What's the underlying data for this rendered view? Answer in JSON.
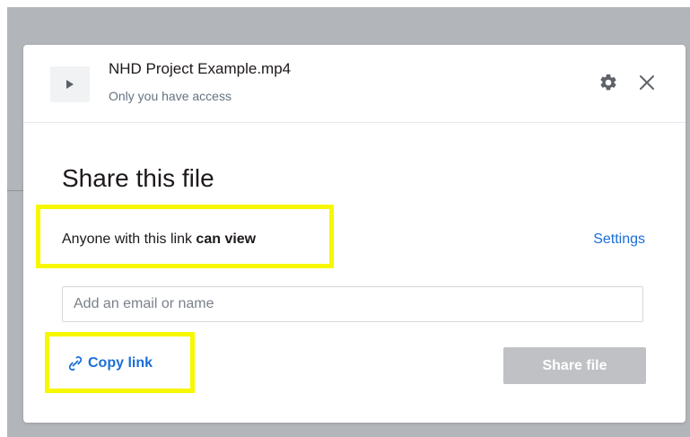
{
  "file": {
    "name": "NHD Project Example.mp4",
    "access": "Only you have access",
    "thumbnail_icon": "play-icon"
  },
  "header_actions": {
    "settings_icon": "gear-icon",
    "close_icon": "close-icon"
  },
  "share": {
    "title": "Share this file",
    "access_prefix": "Anyone with this link",
    "access_level": "can view",
    "settings_label": "Settings",
    "input_placeholder": "Add an email or name",
    "input_value": "",
    "copy_link_label": "Copy link",
    "copy_link_icon": "link-icon",
    "share_button_label": "Share file"
  },
  "colors": {
    "link_blue": "#1a6ed8",
    "highlight_yellow": "#f7f700",
    "disabled_button": "#bfc1c4",
    "backdrop": "#b2b5b9"
  }
}
